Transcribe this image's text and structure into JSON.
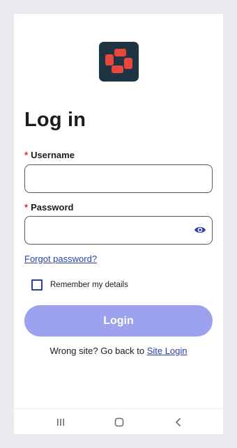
{
  "login": {
    "title": "Log in",
    "username": {
      "required_mark": "*",
      "label": "Username",
      "value": ""
    },
    "password": {
      "required_mark": "*",
      "label": "Password",
      "value": "",
      "reveal_icon": "eye-icon"
    },
    "forgot_password": "Forgot password?",
    "remember_me": {
      "label": "Remember my details",
      "checked": false
    },
    "login_button": "Login",
    "wrong_site": {
      "prefix": "Wrong site? Go back to ",
      "link": "Site Login"
    }
  },
  "nav_bar": {
    "items": [
      "recent-apps-icon",
      "home-icon",
      "back-icon"
    ]
  },
  "colors": {
    "accent": "#2b3fa8",
    "button_disabled": "#9da2ee",
    "required": "#d32f2f",
    "logo_bg": "#1f3442",
    "logo_mark": "#e8473b"
  }
}
